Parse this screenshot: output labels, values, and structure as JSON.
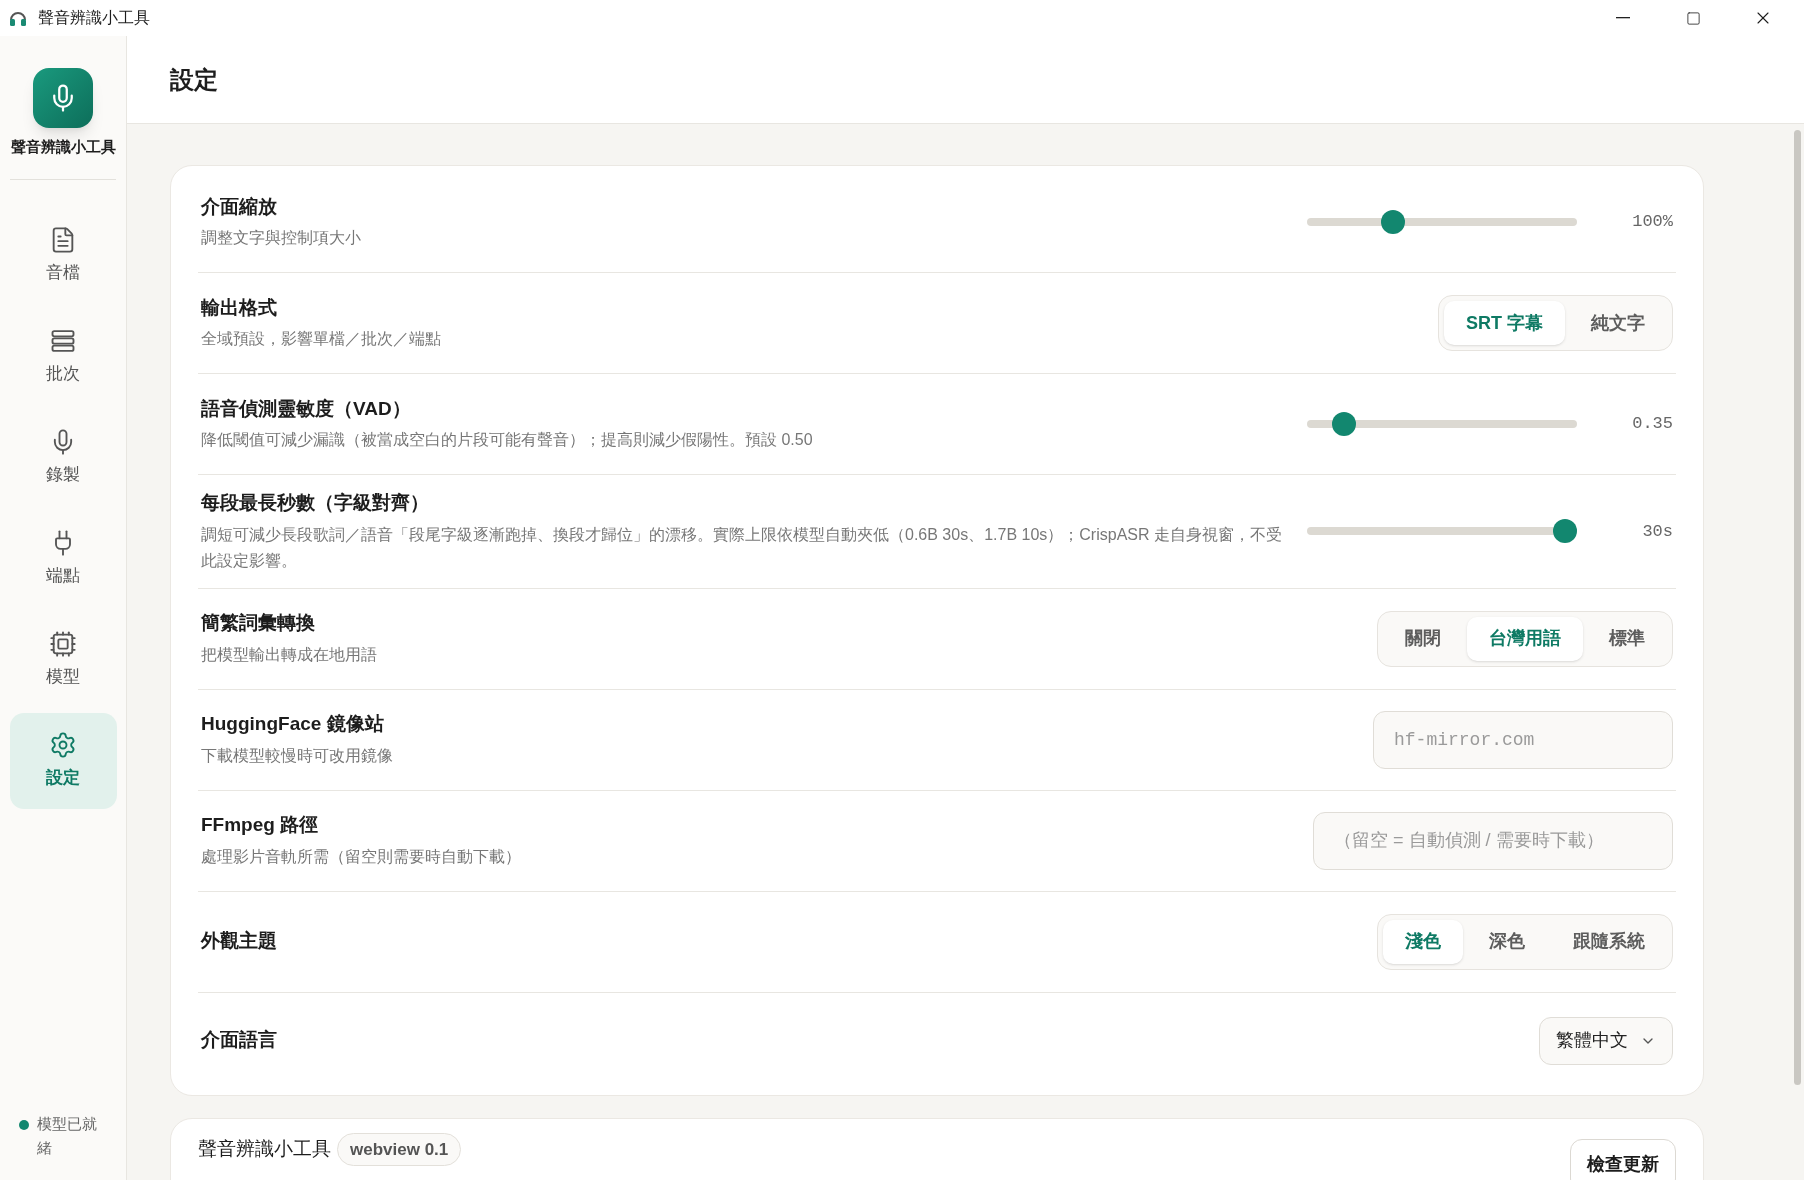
{
  "window": {
    "title": "聲音辨識小工具"
  },
  "sidebar": {
    "brand": "聲音辨識小工具",
    "items": [
      {
        "label": "音檔",
        "selected": false
      },
      {
        "label": "批次",
        "selected": false
      },
      {
        "label": "錄製",
        "selected": false
      },
      {
        "label": "端點",
        "selected": false
      },
      {
        "label": "模型",
        "selected": false
      },
      {
        "label": "設定",
        "selected": true
      }
    ],
    "status": {
      "label": "模型已就緒",
      "ready": true
    }
  },
  "page": {
    "title": "設定"
  },
  "settings": [
    {
      "kind": "slider",
      "label": "介面縮放",
      "description": "調整文字與控制項大小",
      "level": 0.3,
      "reading": "100%"
    },
    {
      "kind": "segmented",
      "label": "輸出格式",
      "description": "全域預設，影響單檔／批次／端點",
      "options": [
        {
          "label": "SRT 字幕",
          "selected": true
        },
        {
          "label": "純文字",
          "selected": false
        }
      ]
    },
    {
      "kind": "slider",
      "label": "語音偵測靈敏度（VAD）",
      "description": "降低閾值可減少漏識（被當成空白的片段可能有聲音）；提高則減少假陽性。預設 0.50",
      "level": 0.1,
      "reading": "0.35"
    },
    {
      "kind": "slider",
      "label": "每段最長秒數（字級對齊）",
      "description": "調短可減少長段歌詞／語音「段尾字級逐漸跑掉、換段才歸位」的漂移。實際上限依模型自動夾低（0.6B 30s、1.7B 10s）；CrispASR 走自身視窗，不受此設定影響。",
      "level": 1.0,
      "reading": "30s"
    },
    {
      "kind": "segmented",
      "label": "簡繁詞彙轉換",
      "description": "把模型輸出轉成在地用語",
      "options": [
        {
          "label": "關閉",
          "selected": false
        },
        {
          "label": "台灣用語",
          "selected": true
        },
        {
          "label": "標準",
          "selected": false
        }
      ]
    },
    {
      "kind": "url",
      "label": "HuggingFace 鏡像站",
      "description": "下載模型較慢時可改用鏡像",
      "placeholder": "hf-mirror.com"
    },
    {
      "kind": "path",
      "label": "FFmpeg 路徑",
      "description": "處理影片音軌所需（留空則需要時自動下載）",
      "placeholder": "（留空 = 自動偵測 / 需要時下載）"
    },
    {
      "kind": "segmented",
      "label": "外觀主題",
      "options": [
        {
          "label": "淺色",
          "selected": true
        },
        {
          "label": "深色",
          "selected": false
        },
        {
          "label": "跟隨系統",
          "selected": false
        }
      ]
    },
    {
      "kind": "select",
      "label": "介面語言",
      "value": "繁體中文"
    }
  ],
  "about": {
    "name": "聲音辨識小工具",
    "version": "webview 0.1",
    "button": "檢查更新"
  }
}
